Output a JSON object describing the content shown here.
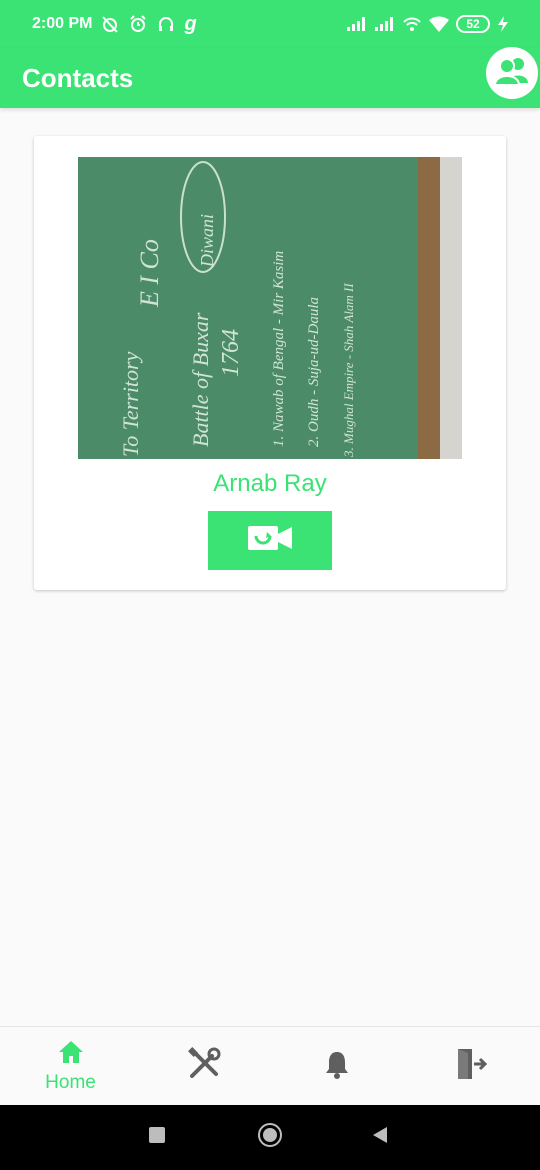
{
  "status_bar": {
    "time": "2:00 PM",
    "carrier_glyph": "g",
    "battery": "52",
    "icons": [
      "alarm-off-icon",
      "alarm-icon",
      "headset-icon",
      "signal-icon",
      "signal-icon",
      "hotspot-icon",
      "wifi-icon",
      "battery-icon",
      "charging-icon"
    ]
  },
  "app_bar": {
    "title": "Contacts",
    "profile_icon": "group-icon"
  },
  "contact": {
    "name": "Arnab Ray",
    "photo_text": {
      "line1": "To Territory",
      "line2": "Battle of Buxar",
      "line3": "1764",
      "line4": "Diwani",
      "line5": "1. Nawab of Bengal - Mir Kasim",
      "line6": "2. Oudh - Suja-ud-Daula",
      "line7": "3. Mughal Empire - Shah Alam II",
      "line8": "E I Co"
    },
    "call_icon": "video-call-icon"
  },
  "bottom_nav": [
    {
      "label": "Home",
      "icon": "home-icon",
      "active": true
    },
    {
      "label": "",
      "icon": "tools-icon",
      "active": false
    },
    {
      "label": "",
      "icon": "bell-icon",
      "active": false
    },
    {
      "label": "",
      "icon": "logout-icon",
      "active": false
    }
  ],
  "system_nav": [
    "recents-icon",
    "home-circle-icon",
    "back-icon"
  ],
  "colors": {
    "accent": "#3ae374",
    "inactive_icon": "#5f5f5f"
  }
}
